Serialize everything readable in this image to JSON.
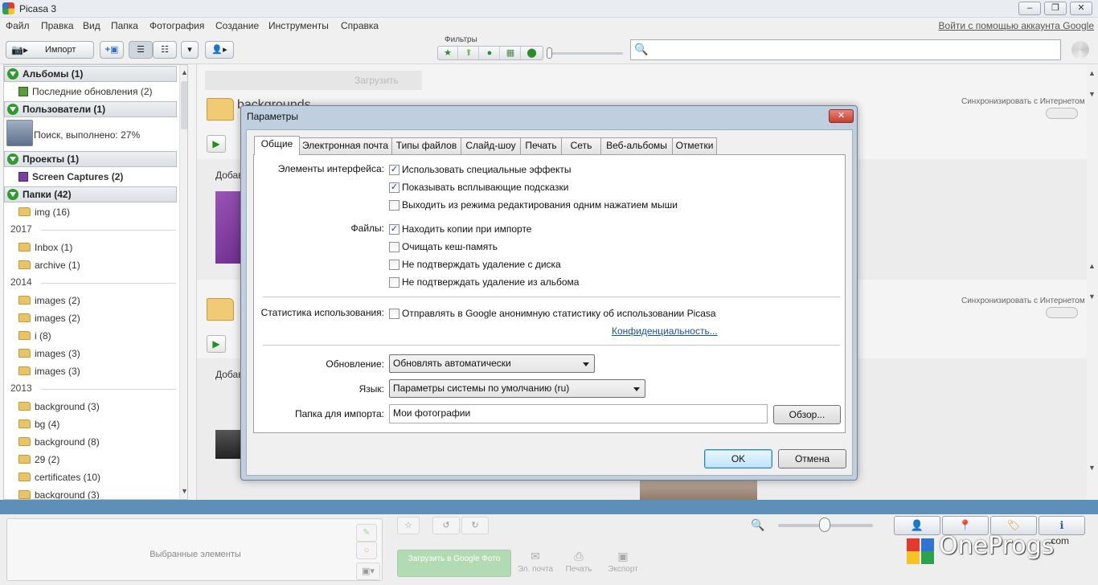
{
  "app": {
    "title": "Picasa 3",
    "window_buttons": [
      "–",
      "❐",
      "✕"
    ]
  },
  "menu": {
    "items": [
      "Файл",
      "Правка",
      "Вид",
      "Папка",
      "Фотография",
      "Создание",
      "Инструменты",
      "Справка"
    ],
    "signin": "Войти с помощью аккаунта Google"
  },
  "toolbar": {
    "import_label": "Импорт",
    "filters_label": "Фильтры"
  },
  "sidebar": {
    "albums": "Альбомы (1)",
    "recent": "Последние обновления (2)",
    "people": "Пользователи (1)",
    "face_search": "Поиск, выполнено: 27%",
    "projects": "Проекты (1)",
    "screen_captures": "Screen Captures (2)",
    "folders": "Папки (42)",
    "folder_img": "img (16)",
    "years": [
      "2017",
      "2014",
      "2013"
    ],
    "y2017": [
      "Inbox (1)",
      "archive (1)"
    ],
    "y2014": [
      "images (2)",
      "images (2)",
      "i (8)",
      "images (3)",
      "images (3)"
    ],
    "y2013": [
      "background (3)",
      "bg (4)",
      "background (8)",
      "29 (2)",
      "certificates (10)",
      "background (3)"
    ]
  },
  "main": {
    "upload_ghost": "Загрузить",
    "folder1_name": "backgrounds",
    "sync_label": "Синхронизировать с Интернетом",
    "add_ghost": "Добав"
  },
  "bottom": {
    "tray_label": "Выбранные элементы",
    "upload_btn": "Загрузить в Google Фото",
    "email": "Эл. почта",
    "print": "Печать",
    "export": "Экспорт"
  },
  "dialog": {
    "title": "Параметры",
    "close": "✕",
    "tabs": [
      "Общие",
      "Электронная почта",
      "Типы файлов",
      "Слайд-шоу",
      "Печать",
      "Сеть",
      "Веб-альбомы",
      "Отметки"
    ],
    "active_tab": "Общие",
    "interface_label": "Элементы интерфейса:",
    "interface_options": [
      {
        "label": "Использовать специальные эффекты",
        "checked": true
      },
      {
        "label": "Показывать всплывающие подсказки",
        "checked": true
      },
      {
        "label": "Выходить из режима редактирования одним нажатием мыши",
        "checked": false
      }
    ],
    "files_label": "Файлы:",
    "files_options": [
      {
        "label": "Находить копии при импорте",
        "checked": true
      },
      {
        "label": "Очищать кеш-память",
        "checked": false
      },
      {
        "label": "Не подтверждать удаление с диска",
        "checked": false
      },
      {
        "label": "Не подтверждать удаление из альбома",
        "checked": false
      }
    ],
    "stats_label": "Статистика использования:",
    "stats_option": {
      "label": "Отправлять в Google анонимную статистику об использовании Picasa",
      "checked": false
    },
    "privacy_link": "Конфиденциальность...",
    "update_label": "Обновление:",
    "update_value": "Обновлять автоматически",
    "language_label": "Язык:",
    "language_value": "Параметры системы по умолчанию (ru)",
    "import_folder_label": "Папка для импорта:",
    "import_folder_value": "Мои фотографии",
    "browse": "Обзор...",
    "ok": "OK",
    "cancel": "Отмена"
  },
  "watermark": {
    "brand": "OneProgs",
    "suffix": ".com"
  },
  "colors": {
    "accent_blue": "#5e8fb8",
    "folder_yellow": "#e8c36a",
    "section_green": "#2f9a2f"
  }
}
